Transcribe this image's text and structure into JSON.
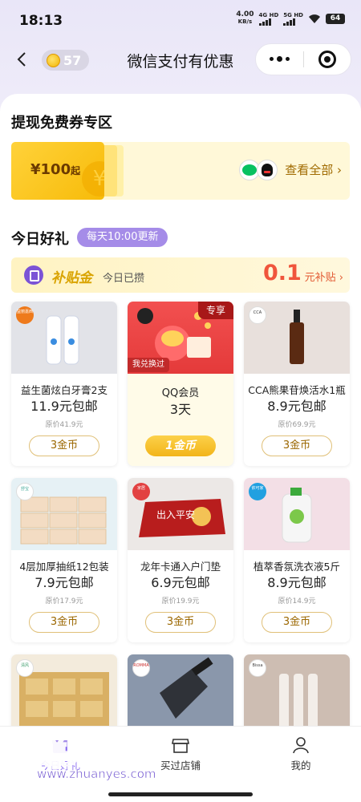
{
  "status": {
    "time": "18:13",
    "net_speed_value": "4.00",
    "net_speed_unit": "KB/s",
    "signal1": "4G HD",
    "signal2": "5G HD",
    "battery": "64"
  },
  "nav": {
    "coin_count": "57",
    "title": "微信支付有优惠"
  },
  "withdraw": {
    "section_title": "提现免费券专区",
    "coupon_amount": "¥100",
    "coupon_suffix": "起",
    "coupon_yen": "¥",
    "view_all": "查看全部 ›"
  },
  "today": {
    "section_title": "今日好礼",
    "update_tag": "每天10:00更新",
    "subsidy_name": "补贴金",
    "subsidy_today": "今日已攒",
    "subsidy_amount": "0.1",
    "subsidy_unit": "元补贴 ›"
  },
  "products": [
    {
      "name": "益生菌炫白牙膏2支",
      "price": "11.9元包邮",
      "orig": "原价41.9元",
      "btn": "3金币",
      "tag": "益丽嘉西"
    },
    {
      "name": "QQ会员",
      "price": "3天",
      "orig": "",
      "btn": "1金币",
      "exclusive": "专享",
      "redeemed": "我兑换过"
    },
    {
      "name": "CCA熊果苷焕活水1瓶",
      "price": "8.9元包邮",
      "orig": "原价69.9元",
      "btn": "3金币",
      "tag": "CCA"
    },
    {
      "name": "4层加厚抽纸12包装",
      "price": "7.9元包邮",
      "orig": "原价17.9元",
      "btn": "3金币",
      "tag": "舒宝"
    },
    {
      "name": "龙年卡通入户门垫",
      "price": "6.9元包邮",
      "orig": "原价19.9元",
      "btn": "3金币",
      "tag": "家居",
      "mat_text": "出入平安"
    },
    {
      "name": "植萃香氛洗衣液5斤",
      "price": "8.9元包邮",
      "orig": "原价14.9元",
      "btn": "3金币",
      "tag": "依可家"
    },
    {
      "tag": "清风"
    },
    {
      "tag": "ROMMA"
    },
    {
      "tag": "Bissa"
    }
  ],
  "tabbar": {
    "tab1": "今日好礼",
    "tab2": "买过店铺",
    "tab3": "我的"
  },
  "watermark": {
    "big": "好赚网",
    "url": "www.zhuanyes.com"
  },
  "colors": {
    "accent_purple": "#a58ce8",
    "gold": "#f7bb09",
    "red_price": "#f0553c"
  }
}
